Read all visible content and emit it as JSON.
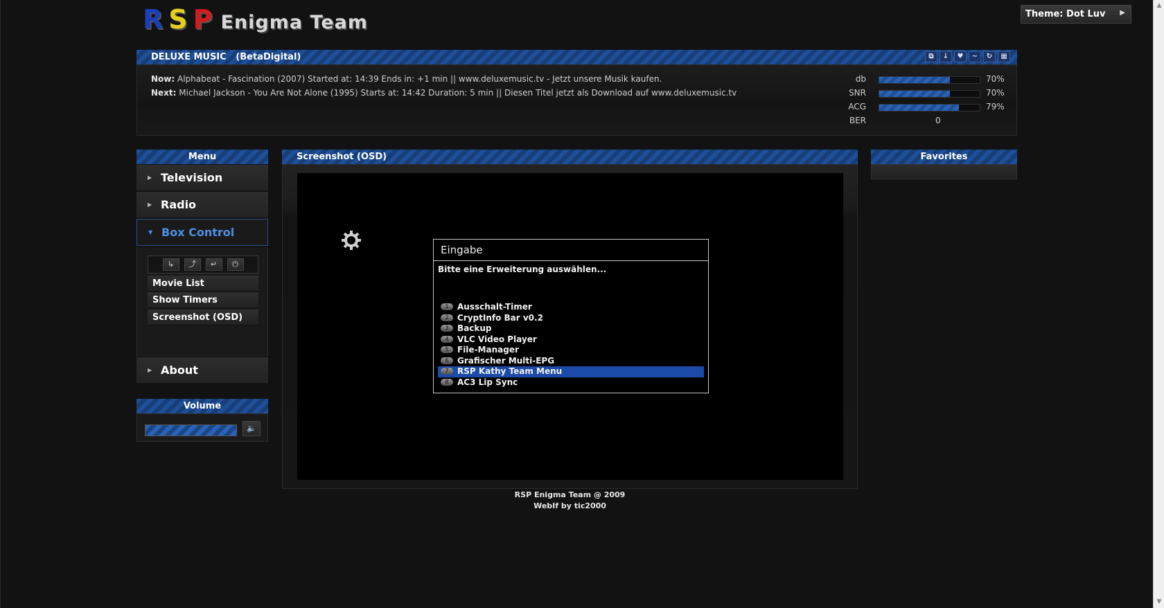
{
  "logo": {
    "r": "R",
    "s": "S",
    "p": "P",
    "team": "Enigma Team"
  },
  "theme": {
    "label": "Theme: Dot Luv"
  },
  "channel": {
    "name": "DELUXE MUSIC",
    "provider": "(BetaDigital)",
    "now_label": "Now:",
    "now_text": "Alphabeat - Fascination (2007) Started at: 14:39 Ends in: +1 min || www.deluxemusic.tv - Jetzt unsere Musik kaufen.",
    "next_label": "Next:",
    "next_text": "Michael Jackson - You Are Not Alone (1995) Starts at: 14:42 Duration: 5 min || Diesen Titel jetzt als Download auf www.deluxemusic.tv",
    "signal": [
      {
        "label": "db",
        "value": "70%",
        "level": 0.7
      },
      {
        "label": "SNR",
        "value": "70%",
        "level": 0.7
      },
      {
        "label": "ACG",
        "value": "79%",
        "level": 0.79
      },
      {
        "label": "BER",
        "value": "0"
      }
    ]
  },
  "sidebar": {
    "menu_title": "Menu",
    "items": [
      {
        "label": "Television"
      },
      {
        "label": "Radio"
      },
      {
        "label": "Box Control"
      },
      {
        "label": "About"
      }
    ],
    "box_control": {
      "subitems": [
        {
          "label": "Movie List"
        },
        {
          "label": "Show Timers"
        },
        {
          "label": "Screenshot (OSD)"
        }
      ]
    },
    "volume_title": "Volume"
  },
  "main": {
    "title": "Screenshot (OSD)",
    "dialog": {
      "title": "Eingabe",
      "prompt": "Bitte eine Erweiterung auswählen...",
      "items": [
        {
          "num": "1",
          "label": "Ausschalt-Timer"
        },
        {
          "num": "2",
          "label": "CryptInfo Bar v0.2"
        },
        {
          "num": "3",
          "label": "Backup"
        },
        {
          "num": "4",
          "label": "VLC Video Player"
        },
        {
          "num": "5",
          "label": "File-Manager"
        },
        {
          "num": "6",
          "label": "Grafischer Multi-EPG"
        },
        {
          "num": "7",
          "label": "RSP Kathy Team Menu"
        },
        {
          "num": "8",
          "label": "AC3 Lip Sync"
        }
      ]
    }
  },
  "favorites": {
    "title": "Favorites"
  },
  "footer": {
    "line1": "RSP Enigma Team @ 2009",
    "line2": "WebIf by tic2000"
  },
  "colors": {
    "accent": "#1e4f97",
    "active_text": "#4f8fe3",
    "selected": "#1b4aa8"
  }
}
